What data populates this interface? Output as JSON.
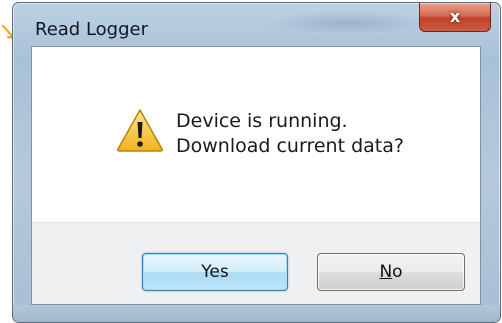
{
  "window": {
    "title": "Read Logger",
    "close_label": "x"
  },
  "dialog": {
    "icon": "warning-icon",
    "message_line1": "Device is running.",
    "message_line2": "Download current data?"
  },
  "buttons": {
    "yes_label": "Yes",
    "no_label_accel": "N",
    "no_label_rest": "o"
  },
  "colors": {
    "annotation_arrow": "#f5a623",
    "warning_yellow": "#f6c642",
    "close_button_red": "#c8452f",
    "default_button_blue": "#3c7fb1"
  }
}
